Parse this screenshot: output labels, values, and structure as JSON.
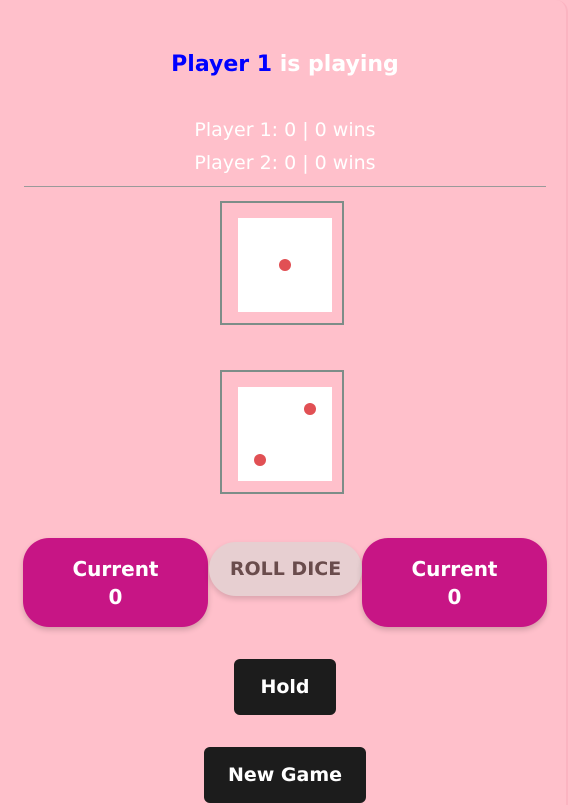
{
  "status": {
    "player": "Player 1",
    "rest": " is playing"
  },
  "scores": {
    "player1": "Player 1: 0 | 0 wins",
    "player2": "Player 2: 0 | 0 wins"
  },
  "dice": [
    {
      "value": 1
    },
    {
      "value": 2
    }
  ],
  "current_left": {
    "label": "Current",
    "value": "0"
  },
  "current_right": {
    "label": "Current",
    "value": "0"
  },
  "controls": {
    "roll": "ROLL DICE",
    "hold": "Hold",
    "new_game": "New Game"
  },
  "colors": {
    "background": "#ffc0cb",
    "player_accent": "#0000ff",
    "card": "#c71585",
    "pip": "#e15054",
    "roll_button": "#e7cfd1",
    "dark_button": "#1c1c1c"
  }
}
